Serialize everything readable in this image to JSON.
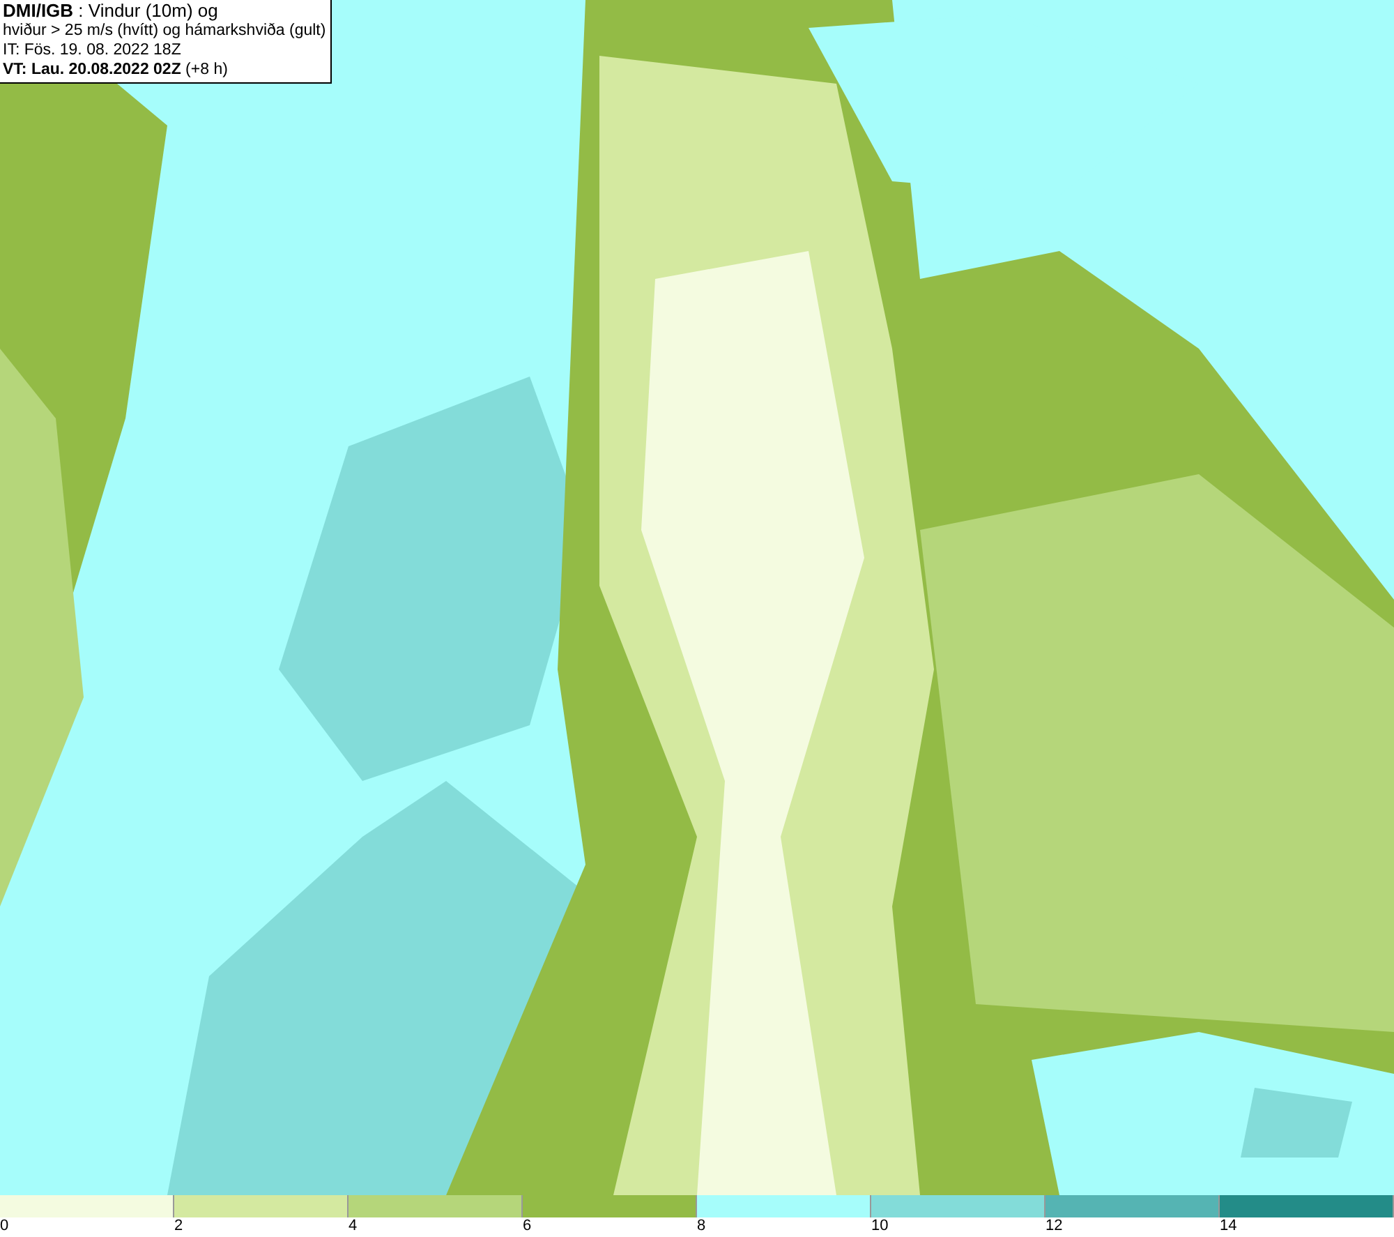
{
  "header": {
    "lines": [
      "**DMI/IGB** : Vindur (10m) og",
      "hviður > 25 m/s (hvítt) og hámarkshviða (gult)",
      "IT: Fös. 19. 08. 2022 18Z",
      "**VT: Lau. 20.08.2022 02Z** (+8 h)"
    ]
  },
  "legend": [
    {
      "label": "0",
      "color": "#f4fbe0"
    },
    {
      "label": "2",
      "color": "#d4e9a0"
    },
    {
      "label": "4",
      "color": "#b5d67a"
    },
    {
      "label": "6",
      "color": "#93bb46"
    },
    {
      "label": "8",
      "color": "#a6fdfb"
    },
    {
      "label": "10",
      "color": "#83dcd9"
    },
    {
      "label": "12",
      "color": "#55b4b3"
    },
    {
      "label": "14",
      "color": "#238c88"
    }
  ]
}
